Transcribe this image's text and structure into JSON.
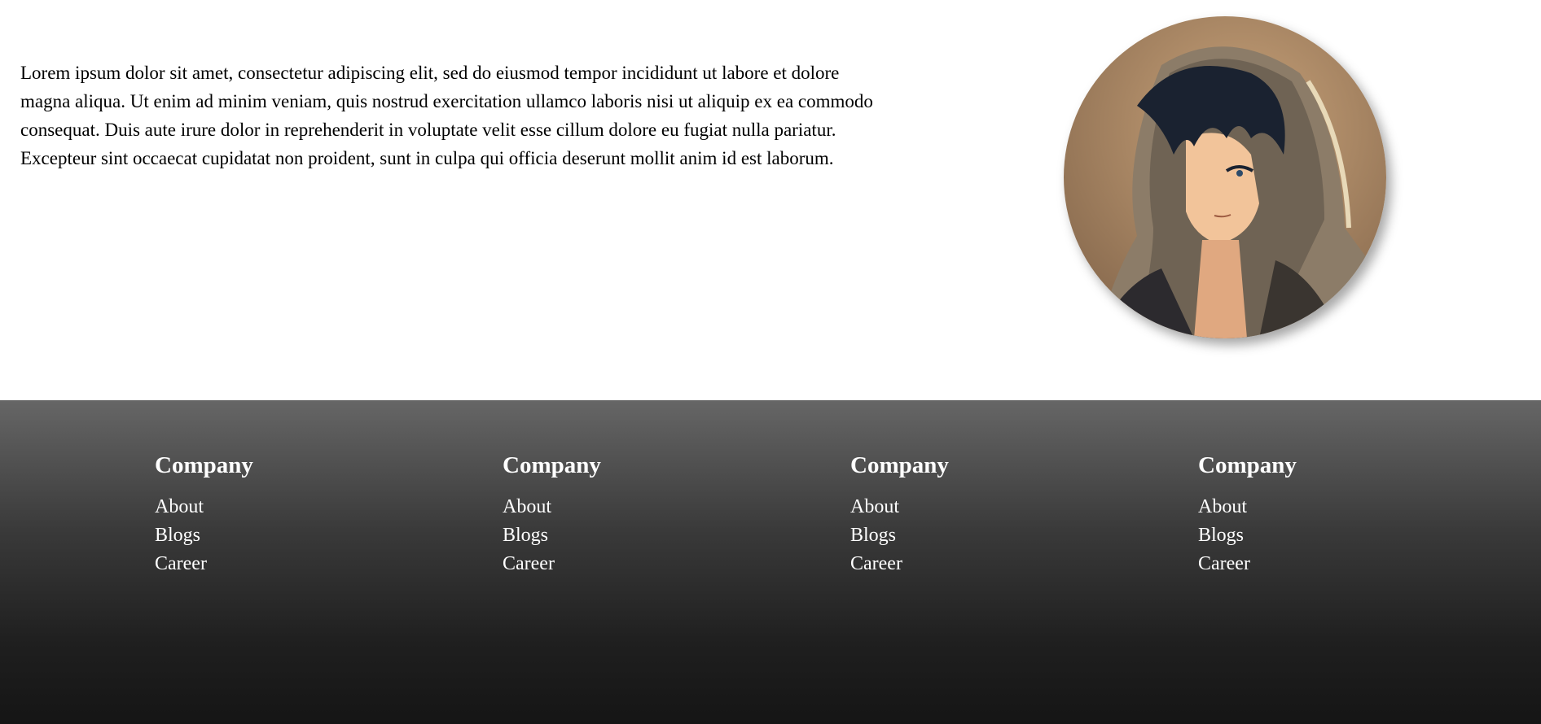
{
  "intro": {
    "text": "Lorem ipsum dolor sit amet, consectetur adipiscing elit, sed do eiusmod tempor incididunt ut labore et dolore magna aliqua. Ut enim ad minim veniam, quis nostrud exercitation ullamco laboris nisi ut aliquip ex ea commodo consequat. Duis aute irure dolor in reprehenderit in voluptate velit esse cillum dolore eu fugiat nulla pariatur. Excepteur sint occaecat cupidatat non proident, sunt in culpa qui officia deserunt mollit anim id est laborum."
  },
  "avatar": {
    "icon": "anime-hooded-character-portrait",
    "colors": {
      "background": "#b08a62",
      "hood": "#8a7a66",
      "hair": "#1a2230",
      "skin": "#f2c49a"
    }
  },
  "footer": {
    "columns": [
      {
        "title": "Company",
        "links": [
          "About",
          "Blogs",
          "Career"
        ]
      },
      {
        "title": "Company",
        "links": [
          "About",
          "Blogs",
          "Career"
        ]
      },
      {
        "title": "Company",
        "links": [
          "About",
          "Blogs",
          "Career"
        ]
      },
      {
        "title": "Company",
        "links": [
          "About",
          "Blogs",
          "Career"
        ]
      }
    ]
  }
}
